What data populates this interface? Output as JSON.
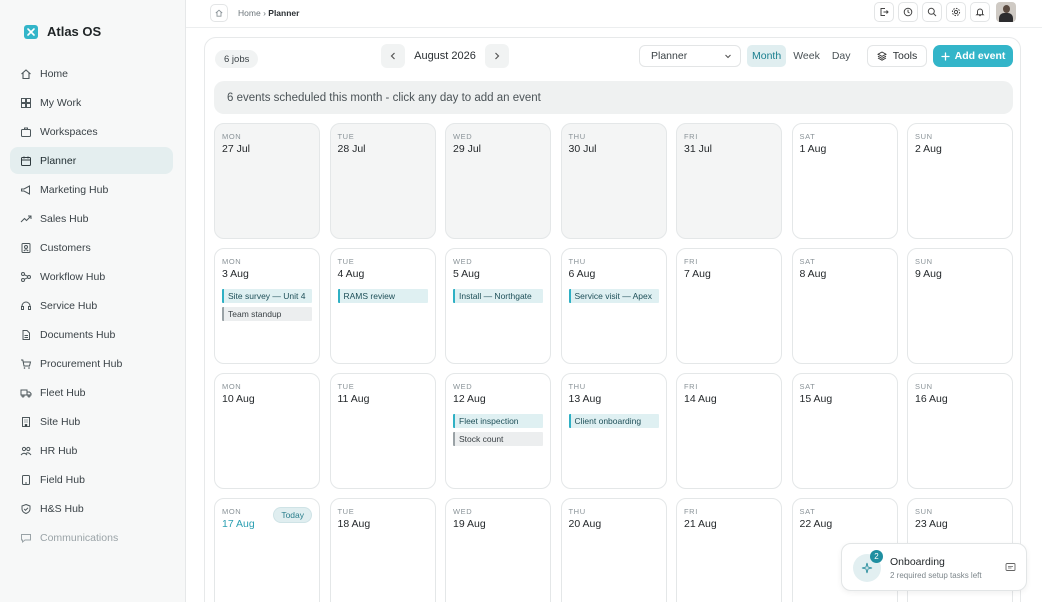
{
  "app": {
    "name": "Atlas OS",
    "accent": "#33b5c9"
  },
  "sidebar": {
    "items": [
      {
        "label": "Home",
        "icon": "home-icon"
      },
      {
        "label": "My Work",
        "icon": "grid-icon"
      },
      {
        "label": "Workspaces",
        "icon": "briefcase-icon"
      },
      {
        "label": "Planner",
        "icon": "calendar-icon",
        "active": true
      },
      {
        "label": "Marketing Hub",
        "icon": "megaphone-icon"
      },
      {
        "label": "Sales Hub",
        "icon": "trend-icon"
      },
      {
        "label": "Customers",
        "icon": "contacts-icon"
      },
      {
        "label": "Workflow Hub",
        "icon": "workflow-icon"
      },
      {
        "label": "Service Hub",
        "icon": "headset-icon"
      },
      {
        "label": "Documents Hub",
        "icon": "document-icon"
      },
      {
        "label": "Procurement Hub",
        "icon": "cart-icon"
      },
      {
        "label": "Fleet Hub",
        "icon": "truck-icon"
      },
      {
        "label": "Site Hub",
        "icon": "building-icon"
      },
      {
        "label": "HR Hub",
        "icon": "people-icon"
      },
      {
        "label": "Field Hub",
        "icon": "tablet-icon"
      },
      {
        "label": "H&S Hub",
        "icon": "shield-icon"
      },
      {
        "label": "Communications",
        "icon": "chat-icon",
        "muted": true
      }
    ]
  },
  "topbar": {
    "breadcrumb_home": "Home",
    "breadcrumb_sep": "›",
    "breadcrumb_current": "Planner",
    "icons": [
      "logout-icon",
      "history-icon",
      "search-icon",
      "gear-icon",
      "bell-icon"
    ]
  },
  "planner": {
    "jobs_count": "6 jobs",
    "month_label": "August 2026",
    "view_select": "Planner",
    "view_tabs": [
      {
        "label": "Month",
        "active": true
      },
      {
        "label": "Week"
      },
      {
        "label": "Day"
      }
    ],
    "tools_label": "Tools",
    "add_event_label": "Add event",
    "banner": "6 events scheduled this month - click any day to add an event",
    "today_label": "Today"
  },
  "calendar": {
    "days": [
      {
        "name": "MON",
        "date": "27 Jul",
        "past": true,
        "events": []
      },
      {
        "name": "TUE",
        "date": "28 Jul",
        "past": true,
        "events": []
      },
      {
        "name": "WED",
        "date": "29 Jul",
        "past": true,
        "events": []
      },
      {
        "name": "THU",
        "date": "30 Jul",
        "past": true,
        "events": []
      },
      {
        "name": "FRI",
        "date": "31 Jul",
        "past": true,
        "events": []
      },
      {
        "name": "SAT",
        "date": "1 Aug",
        "events": []
      },
      {
        "name": "SUN",
        "date": "2 Aug",
        "events": []
      },
      {
        "name": "MON",
        "date": "3 Aug",
        "events": [
          {
            "title": "Site survey — Unit 4",
            "kind": "job"
          },
          {
            "title": "Team standup",
            "kind": "internal"
          }
        ]
      },
      {
        "name": "TUE",
        "date": "4 Aug",
        "events": [
          {
            "title": "RAMS review",
            "kind": "job"
          }
        ]
      },
      {
        "name": "WED",
        "date": "5 Aug",
        "events": [
          {
            "title": "Install — Northgate",
            "kind": "job"
          }
        ]
      },
      {
        "name": "THU",
        "date": "6 Aug",
        "events": [
          {
            "title": "Service visit — Apex",
            "kind": "job"
          }
        ]
      },
      {
        "name": "FRI",
        "date": "7 Aug",
        "events": []
      },
      {
        "name": "SAT",
        "date": "8 Aug",
        "events": []
      },
      {
        "name": "SUN",
        "date": "9 Aug",
        "events": []
      },
      {
        "name": "MON",
        "date": "10 Aug",
        "events": []
      },
      {
        "name": "TUE",
        "date": "11 Aug",
        "events": []
      },
      {
        "name": "WED",
        "date": "12 Aug",
        "events": [
          {
            "title": "Fleet inspection",
            "kind": "job"
          },
          {
            "title": "Stock count",
            "kind": "internal"
          }
        ]
      },
      {
        "name": "THU",
        "date": "13 Aug",
        "events": [
          {
            "title": "Client onboarding",
            "kind": "job"
          }
        ]
      },
      {
        "name": "FRI",
        "date": "14 Aug",
        "events": []
      },
      {
        "name": "SAT",
        "date": "15 Aug",
        "events": []
      },
      {
        "name": "SUN",
        "date": "16 Aug",
        "events": []
      },
      {
        "name": "MON",
        "date": "17 Aug",
        "today": true,
        "events": []
      },
      {
        "name": "TUE",
        "date": "18 Aug",
        "events": []
      },
      {
        "name": "WED",
        "date": "19 Aug",
        "events": []
      },
      {
        "name": "THU",
        "date": "20 Aug",
        "events": []
      },
      {
        "name": "FRI",
        "date": "21 Aug",
        "events": []
      },
      {
        "name": "SAT",
        "date": "22 Aug",
        "events": []
      },
      {
        "name": "SUN",
        "date": "23 Aug",
        "events": []
      }
    ]
  },
  "onboarding": {
    "badge_count": "2",
    "title": "Onboarding",
    "subtitle": "2 required setup tasks left"
  }
}
